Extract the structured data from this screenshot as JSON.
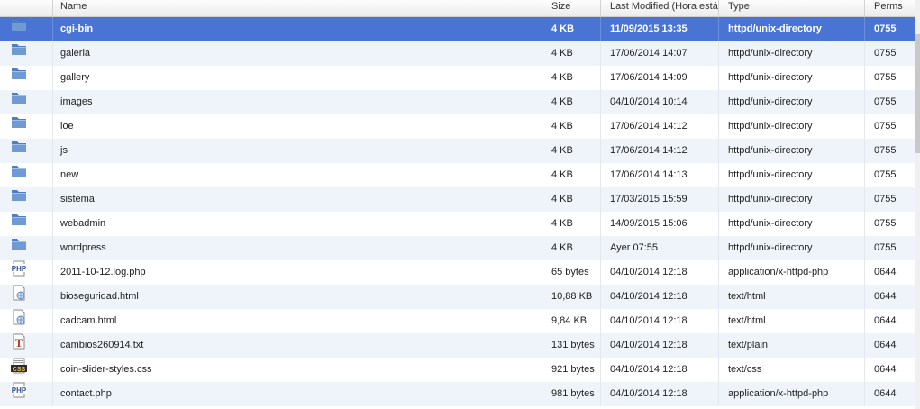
{
  "columns": {
    "icon": "",
    "name": "Name",
    "size": "Size",
    "modified": "Last Modified (Hora está",
    "type": "Type",
    "perms": "Perms"
  },
  "files": [
    {
      "icon": "folder-icon",
      "name": "cgi-bin",
      "size": "4 KB",
      "modified": "11/09/2015 13:35",
      "type": "httpd/unix-directory",
      "perms": "0755",
      "selected": true
    },
    {
      "icon": "folder-icon",
      "name": "galeria",
      "size": "4 KB",
      "modified": "17/06/2014 14:07",
      "type": "httpd/unix-directory",
      "perms": "0755"
    },
    {
      "icon": "folder-icon",
      "name": "gallery",
      "size": "4 KB",
      "modified": "17/06/2014 14:09",
      "type": "httpd/unix-directory",
      "perms": "0755"
    },
    {
      "icon": "folder-icon",
      "name": "images",
      "size": "4 KB",
      "modified": "04/10/2014 10:14",
      "type": "httpd/unix-directory",
      "perms": "0755"
    },
    {
      "icon": "folder-icon",
      "name": "ioe",
      "size": "4 KB",
      "modified": "17/06/2014 14:12",
      "type": "httpd/unix-directory",
      "perms": "0755"
    },
    {
      "icon": "folder-icon",
      "name": "js",
      "size": "4 KB",
      "modified": "17/06/2014 14:12",
      "type": "httpd/unix-directory",
      "perms": "0755"
    },
    {
      "icon": "folder-icon",
      "name": "new",
      "size": "4 KB",
      "modified": "17/06/2014 14:13",
      "type": "httpd/unix-directory",
      "perms": "0755"
    },
    {
      "icon": "folder-icon",
      "name": "sistema",
      "size": "4 KB",
      "modified": "17/03/2015 15:59",
      "type": "httpd/unix-directory",
      "perms": "0755"
    },
    {
      "icon": "folder-icon",
      "name": "webadmin",
      "size": "4 KB",
      "modified": "14/09/2015 15:06",
      "type": "httpd/unix-directory",
      "perms": "0755"
    },
    {
      "icon": "folder-icon",
      "name": "wordpress",
      "size": "4 KB",
      "modified": "Ayer 07:55",
      "type": "httpd/unix-directory",
      "perms": "0755"
    },
    {
      "icon": "php-file-icon",
      "name": "2011-10-12.log.php",
      "size": "65 bytes",
      "modified": "04/10/2014 12:18",
      "type": "application/x-httpd-php",
      "perms": "0644"
    },
    {
      "icon": "html-file-icon",
      "name": "bioseguridad.html",
      "size": "10,88 KB",
      "modified": "04/10/2014 12:18",
      "type": "text/html",
      "perms": "0644"
    },
    {
      "icon": "html-file-icon",
      "name": "cadcam.html",
      "size": "9,84 KB",
      "modified": "04/10/2014 12:18",
      "type": "text/html",
      "perms": "0644"
    },
    {
      "icon": "text-file-icon",
      "name": "cambios260914.txt",
      "size": "131 bytes",
      "modified": "04/10/2014 12:18",
      "type": "text/plain",
      "perms": "0644"
    },
    {
      "icon": "css-file-icon",
      "name": "coin-slider-styles.css",
      "size": "921 bytes",
      "modified": "04/10/2014 12:18",
      "type": "text/css",
      "perms": "0644"
    },
    {
      "icon": "php-file-icon",
      "name": "contact.php",
      "size": "981 bytes",
      "modified": "04/10/2014 12:18",
      "type": "application/x-httpd-php",
      "perms": "0644"
    }
  ],
  "colors": {
    "selected_row": "#4a74d4",
    "alt_row": "#eef4fa",
    "folder": "#5b86c4"
  }
}
